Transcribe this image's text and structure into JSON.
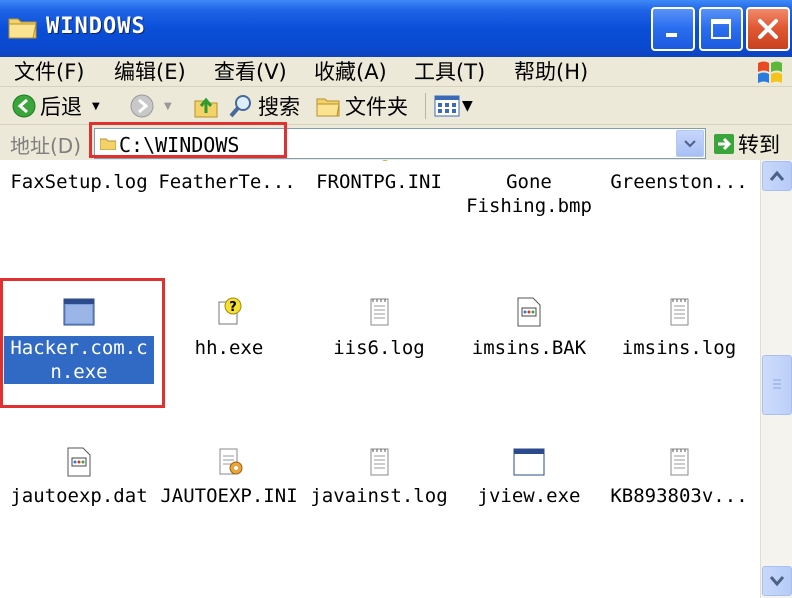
{
  "window": {
    "title": "WINDOWS"
  },
  "menu": [
    {
      "label": "文件(F)"
    },
    {
      "label": "编辑(E)"
    },
    {
      "label": "查看(V)"
    },
    {
      "label": "收藏(A)"
    },
    {
      "label": "工具(T)"
    },
    {
      "label": "帮助(H)"
    }
  ],
  "toolbar": {
    "back_label": "后退",
    "search_label": "搜索",
    "folders_label": "文件夹"
  },
  "address": {
    "label": "地址(D)",
    "path": "C:\\WINDOWS",
    "go_label": "转到"
  },
  "files": [
    {
      "name": "FaxSetup.log",
      "icon": "log-icon"
    },
    {
      "name": "FeatherTe...",
      "icon": "file-icon"
    },
    {
      "name": "FRONTPG.INI",
      "icon": "ini-icon"
    },
    {
      "name": "Gone\nFishing.bmp",
      "icon": "bmp-icon"
    },
    {
      "name": "Greenston...",
      "icon": "bmp-icon"
    },
    {
      "name": "Hacker.com.c\nn.exe",
      "icon": "exe-icon",
      "selected": true
    },
    {
      "name": "hh.exe",
      "icon": "help-exe-icon"
    },
    {
      "name": "iis6.log",
      "icon": "log-icon"
    },
    {
      "name": "imsins.BAK",
      "icon": "bak-icon"
    },
    {
      "name": "imsins.log",
      "icon": "log-icon"
    },
    {
      "name": "jautoexp.dat",
      "icon": "dat-icon"
    },
    {
      "name": "JAUTOEXP.INI",
      "icon": "ini-icon"
    },
    {
      "name": "javainst.log",
      "icon": "log-icon"
    },
    {
      "name": "jview.exe",
      "icon": "exe-icon"
    },
    {
      "name": "KB893803v...",
      "icon": "log-icon"
    }
  ],
  "colors": {
    "titlebar": "#0a4fd8",
    "selection": "#316ac5",
    "highlight_box": "#e03030"
  }
}
